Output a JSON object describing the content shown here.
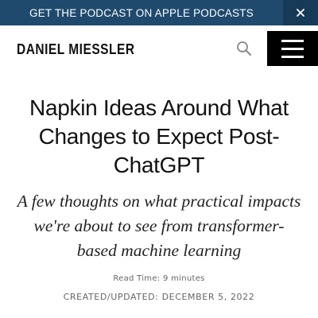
{
  "promo": {
    "text": "GET THE PODCAST ON APPLE PODCASTS",
    "close_icon": "close-icon",
    "background": "#1f4a6e"
  },
  "header": {
    "logo_text": "DANIEL MIESSLER",
    "search_icon": "search-icon",
    "menu_icon": "hamburger-menu-icon"
  },
  "article": {
    "title": "Napkin Ideas Around What Changes to Expect Post-ChatGPT",
    "subtitle": "A few thoughts on what practical impacts we're about to see from transformer-based machine learning",
    "read_time": "Read Time: 9 minutes",
    "date_line": "CREATED/UPDATED: DECEMBER 5, 2022"
  }
}
